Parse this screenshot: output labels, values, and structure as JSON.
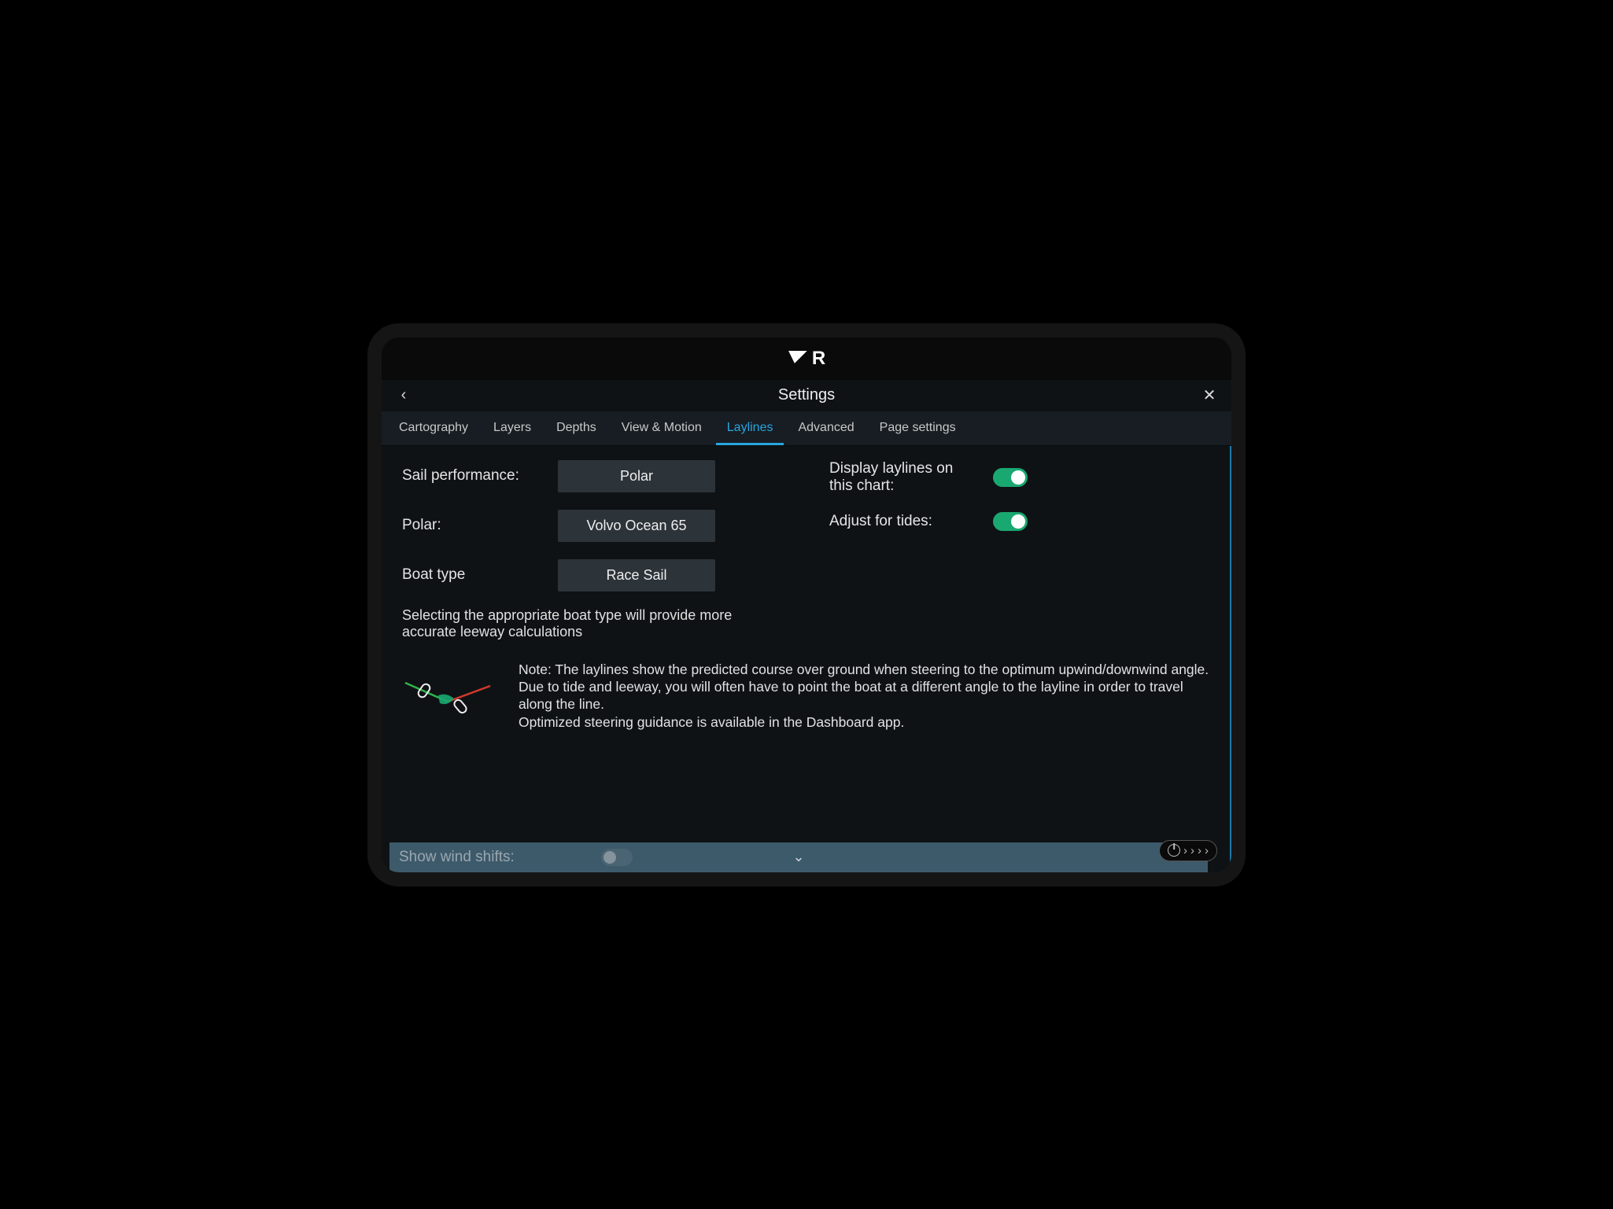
{
  "header": {
    "title": "Settings"
  },
  "tabs": [
    {
      "label": "Cartography",
      "active": false
    },
    {
      "label": "Layers",
      "active": false
    },
    {
      "label": "Depths",
      "active": false
    },
    {
      "label": "View & Motion",
      "active": false
    },
    {
      "label": "Laylines",
      "active": true
    },
    {
      "label": "Advanced",
      "active": false
    },
    {
      "label": "Page settings",
      "active": false
    }
  ],
  "settings": {
    "sail_performance": {
      "label": "Sail performance:",
      "value": "Polar"
    },
    "polar": {
      "label": "Polar:",
      "value": "Volvo Ocean 65"
    },
    "boat_type": {
      "label": "Boat type",
      "value": "Race Sail"
    },
    "display_laylines": {
      "label": "Display laylines on this chart:",
      "on": true
    },
    "adjust_for_tides": {
      "label": "Adjust for tides:",
      "on": true
    },
    "helper_text": "Selecting the appropriate boat type will provide more accurate leeway calculations",
    "note_text": "Note:  The laylines show the predicted course over ground when steering to the optimum upwind/downwind angle. Due to tide and leeway, you will often have to point the boat at a different angle to the layline in order to travel along the line.\nOptimized steering guidance is available in the Dashboard app.",
    "show_wind_shifts": {
      "label": "Show wind shifts:",
      "on": false
    }
  }
}
